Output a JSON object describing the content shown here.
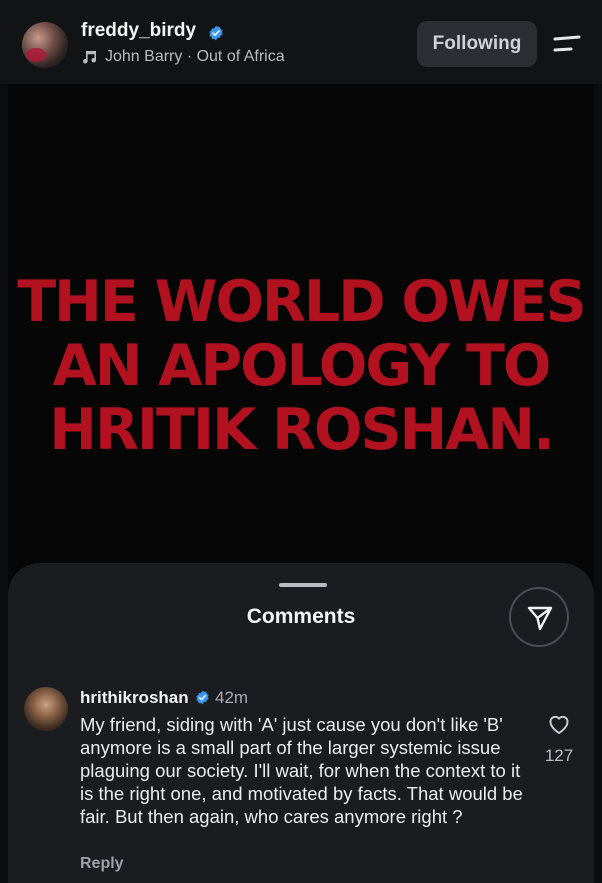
{
  "header": {
    "username": "freddy_birdy",
    "music": "John Barry · Out of Africa",
    "follow_label": "Following"
  },
  "video": {
    "headline_lines": [
      "THE WORLD OWES",
      "AN APOLOGY TO",
      "HRITIK ROSHAN."
    ],
    "headline_color": "#b2121f"
  },
  "comments": {
    "title": "Comments",
    "items": [
      {
        "username": "hrithikroshan",
        "time": "42m",
        "text": "My friend, siding with 'A' just cause you don't like 'B' anymore is a small part of the larger systemic issue plaguing our society.  I'll wait, for when the context to it is the right one, and motivated by facts. That would be fair. But then again, who cares anymore right ?",
        "likes": "127",
        "reply_label": "Reply"
      }
    ]
  },
  "icons": {
    "verified": "verified-badge-icon",
    "music": "music-note-icon",
    "menu": "menu-icon",
    "share": "send-icon",
    "like": "heart-icon"
  },
  "colors": {
    "accent_verified": "#3897f0",
    "background": "#0b0c0e"
  }
}
